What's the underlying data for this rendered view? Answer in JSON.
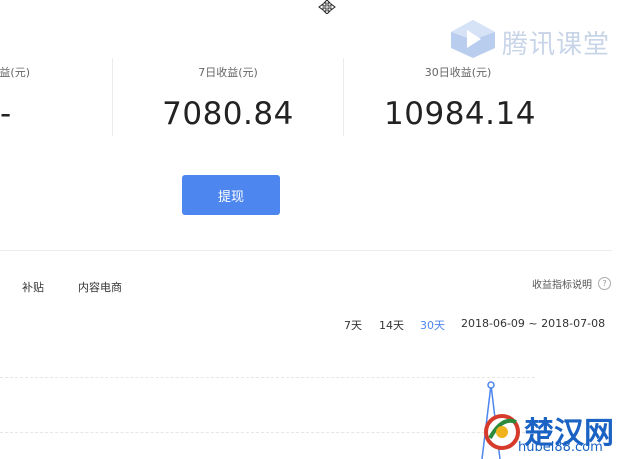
{
  "stats": [
    {
      "label": "益(元)",
      "value": "-"
    },
    {
      "label": "7日收益(元)",
      "value": "7080.84"
    },
    {
      "label": "30日收益(元)",
      "value": "10984.14"
    }
  ],
  "actions": {
    "withdraw_label": "提现"
  },
  "tabs": [
    "补贴",
    "内容电商"
  ],
  "metrics_help": {
    "label": "收益指标说明",
    "icon": "question-circle-icon"
  },
  "ranges": {
    "items": [
      "7天",
      "14天",
      "30天"
    ],
    "active": "30天"
  },
  "date_range": "2018-06-09 ~ 2018-07-08",
  "logo": {
    "text": "腾讯课堂",
    "icon": "play-cube-icon"
  },
  "watermark": {
    "text": "楚汉网",
    "url": "hubei88.com"
  },
  "colors": {
    "accent": "#4d86ee",
    "logo": "#c8d4e8",
    "watermark": "#1a63c4"
  }
}
